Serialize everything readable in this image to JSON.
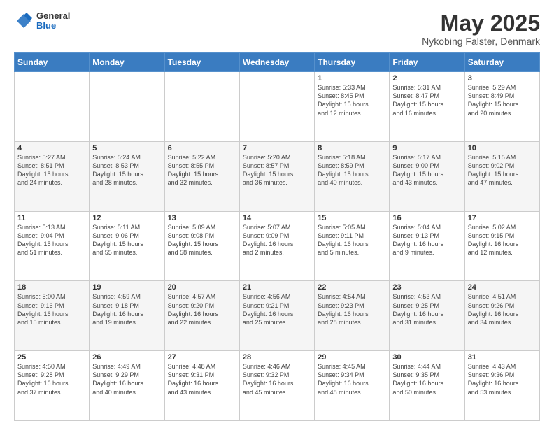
{
  "header": {
    "logo_general": "General",
    "logo_blue": "Blue",
    "title": "May 2025",
    "subtitle": "Nykobing Falster, Denmark"
  },
  "days_of_week": [
    "Sunday",
    "Monday",
    "Tuesday",
    "Wednesday",
    "Thursday",
    "Friday",
    "Saturday"
  ],
  "weeks": [
    [
      {
        "day": "",
        "info": ""
      },
      {
        "day": "",
        "info": ""
      },
      {
        "day": "",
        "info": ""
      },
      {
        "day": "",
        "info": ""
      },
      {
        "day": "1",
        "info": "Sunrise: 5:33 AM\nSunset: 8:45 PM\nDaylight: 15 hours\nand 12 minutes."
      },
      {
        "day": "2",
        "info": "Sunrise: 5:31 AM\nSunset: 8:47 PM\nDaylight: 15 hours\nand 16 minutes."
      },
      {
        "day": "3",
        "info": "Sunrise: 5:29 AM\nSunset: 8:49 PM\nDaylight: 15 hours\nand 20 minutes."
      }
    ],
    [
      {
        "day": "4",
        "info": "Sunrise: 5:27 AM\nSunset: 8:51 PM\nDaylight: 15 hours\nand 24 minutes."
      },
      {
        "day": "5",
        "info": "Sunrise: 5:24 AM\nSunset: 8:53 PM\nDaylight: 15 hours\nand 28 minutes."
      },
      {
        "day": "6",
        "info": "Sunrise: 5:22 AM\nSunset: 8:55 PM\nDaylight: 15 hours\nand 32 minutes."
      },
      {
        "day": "7",
        "info": "Sunrise: 5:20 AM\nSunset: 8:57 PM\nDaylight: 15 hours\nand 36 minutes."
      },
      {
        "day": "8",
        "info": "Sunrise: 5:18 AM\nSunset: 8:59 PM\nDaylight: 15 hours\nand 40 minutes."
      },
      {
        "day": "9",
        "info": "Sunrise: 5:17 AM\nSunset: 9:00 PM\nDaylight: 15 hours\nand 43 minutes."
      },
      {
        "day": "10",
        "info": "Sunrise: 5:15 AM\nSunset: 9:02 PM\nDaylight: 15 hours\nand 47 minutes."
      }
    ],
    [
      {
        "day": "11",
        "info": "Sunrise: 5:13 AM\nSunset: 9:04 PM\nDaylight: 15 hours\nand 51 minutes."
      },
      {
        "day": "12",
        "info": "Sunrise: 5:11 AM\nSunset: 9:06 PM\nDaylight: 15 hours\nand 55 minutes."
      },
      {
        "day": "13",
        "info": "Sunrise: 5:09 AM\nSunset: 9:08 PM\nDaylight: 15 hours\nand 58 minutes."
      },
      {
        "day": "14",
        "info": "Sunrise: 5:07 AM\nSunset: 9:09 PM\nDaylight: 16 hours\nand 2 minutes."
      },
      {
        "day": "15",
        "info": "Sunrise: 5:05 AM\nSunset: 9:11 PM\nDaylight: 16 hours\nand 5 minutes."
      },
      {
        "day": "16",
        "info": "Sunrise: 5:04 AM\nSunset: 9:13 PM\nDaylight: 16 hours\nand 9 minutes."
      },
      {
        "day": "17",
        "info": "Sunrise: 5:02 AM\nSunset: 9:15 PM\nDaylight: 16 hours\nand 12 minutes."
      }
    ],
    [
      {
        "day": "18",
        "info": "Sunrise: 5:00 AM\nSunset: 9:16 PM\nDaylight: 16 hours\nand 15 minutes."
      },
      {
        "day": "19",
        "info": "Sunrise: 4:59 AM\nSunset: 9:18 PM\nDaylight: 16 hours\nand 19 minutes."
      },
      {
        "day": "20",
        "info": "Sunrise: 4:57 AM\nSunset: 9:20 PM\nDaylight: 16 hours\nand 22 minutes."
      },
      {
        "day": "21",
        "info": "Sunrise: 4:56 AM\nSunset: 9:21 PM\nDaylight: 16 hours\nand 25 minutes."
      },
      {
        "day": "22",
        "info": "Sunrise: 4:54 AM\nSunset: 9:23 PM\nDaylight: 16 hours\nand 28 minutes."
      },
      {
        "day": "23",
        "info": "Sunrise: 4:53 AM\nSunset: 9:25 PM\nDaylight: 16 hours\nand 31 minutes."
      },
      {
        "day": "24",
        "info": "Sunrise: 4:51 AM\nSunset: 9:26 PM\nDaylight: 16 hours\nand 34 minutes."
      }
    ],
    [
      {
        "day": "25",
        "info": "Sunrise: 4:50 AM\nSunset: 9:28 PM\nDaylight: 16 hours\nand 37 minutes."
      },
      {
        "day": "26",
        "info": "Sunrise: 4:49 AM\nSunset: 9:29 PM\nDaylight: 16 hours\nand 40 minutes."
      },
      {
        "day": "27",
        "info": "Sunrise: 4:48 AM\nSunset: 9:31 PM\nDaylight: 16 hours\nand 43 minutes."
      },
      {
        "day": "28",
        "info": "Sunrise: 4:46 AM\nSunset: 9:32 PM\nDaylight: 16 hours\nand 45 minutes."
      },
      {
        "day": "29",
        "info": "Sunrise: 4:45 AM\nSunset: 9:34 PM\nDaylight: 16 hours\nand 48 minutes."
      },
      {
        "day": "30",
        "info": "Sunrise: 4:44 AM\nSunset: 9:35 PM\nDaylight: 16 hours\nand 50 minutes."
      },
      {
        "day": "31",
        "info": "Sunrise: 4:43 AM\nSunset: 9:36 PM\nDaylight: 16 hours\nand 53 minutes."
      }
    ]
  ]
}
